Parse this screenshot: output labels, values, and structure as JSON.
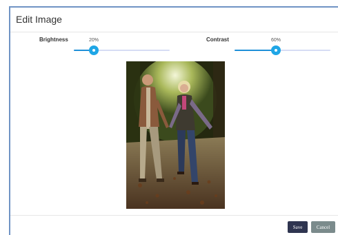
{
  "dialog": {
    "title": "Edit Image"
  },
  "controls": {
    "brightness": {
      "label": "Brightness",
      "value_text": "20%",
      "value": 0.2
    },
    "contrast": {
      "label": "Contrast",
      "value_text": "60%",
      "value": 0.6
    }
  },
  "image": {
    "alt": "Couple walking hand in hand on an autumn leaf-covered path"
  },
  "footer": {
    "save_label": "Save",
    "cancel_label": "Cancel"
  },
  "colors": {
    "accent": "#1fa6e6",
    "save_button": "#2f3550",
    "cancel_button": "#7b8b8c",
    "dialog_border": "#6f93c4"
  }
}
